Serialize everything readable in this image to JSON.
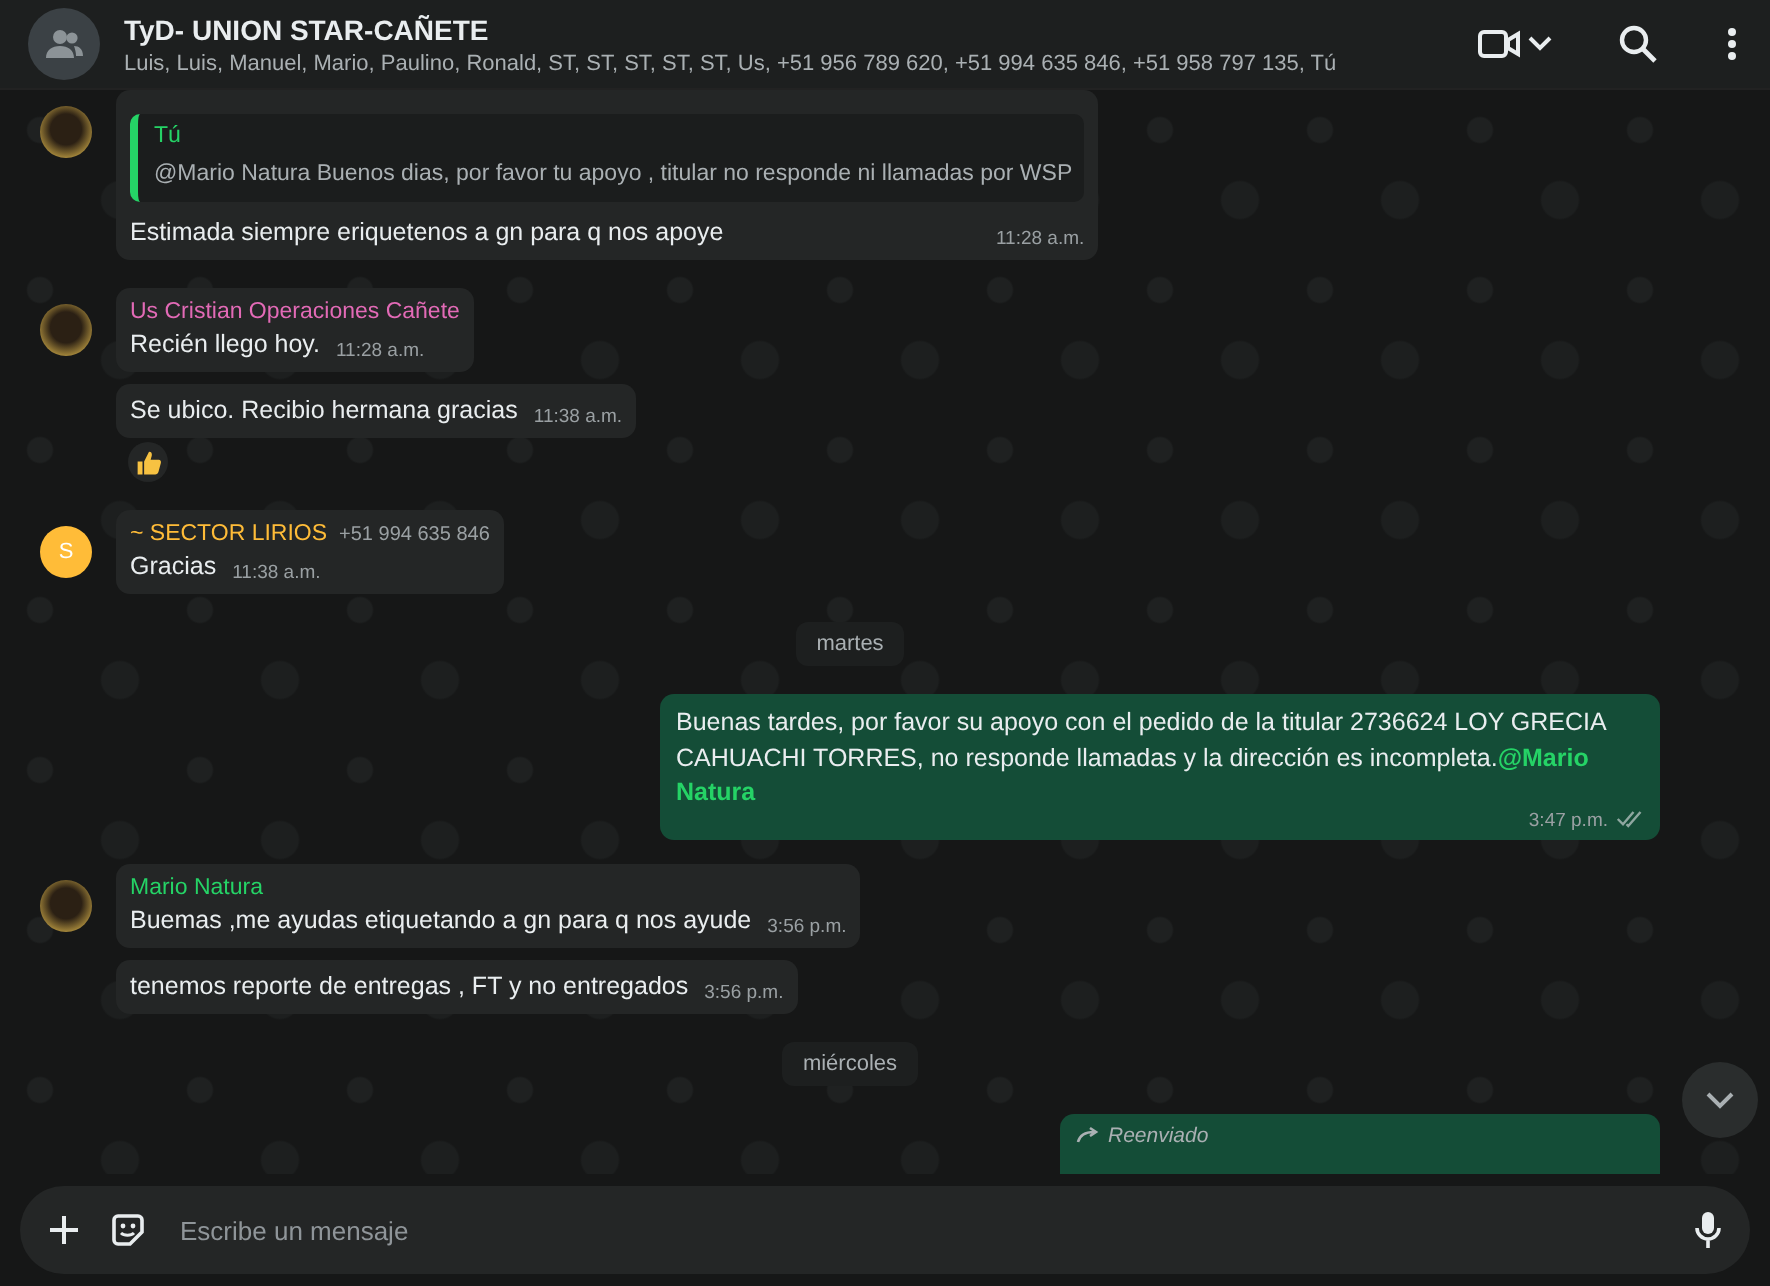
{
  "header": {
    "title": "TyD- UNION STAR-CAÑETE",
    "participants": "Luis, Luis, Manuel, Mario, Paulino, Ronald, ST, ST, ST, ST, ST, Us, +51 956 789 620, +51 994 635 846, +51 958 797 135, Tú"
  },
  "messages": [
    {
      "kind": "incoming",
      "messages": [
        {
          "quote": {
            "author": "Tú",
            "text": "@Mario Natura Buenos dias, por favor tu apoyo , titular no responde ni llamadas por WSP"
          },
          "text": "Estimada siempre eriquetenos a gn para q nos apoye",
          "time": "11:28 a.m."
        }
      ]
    },
    {
      "kind": "incoming",
      "sender": "Us Cristian Operaciones Cañete",
      "color": "#e26ab6",
      "messages": [
        {
          "text": "Recién llego hoy.",
          "time": "11:28 a.m."
        },
        {
          "text": "Se ubico. Recibio hermana gracias",
          "time": "11:38 a.m.",
          "thumbs_up_reaction": true
        }
      ]
    },
    {
      "kind": "incoming",
      "letter": "S",
      "sender": "~ SECTOR LIRIOS",
      "phone": "+51 994 635 846",
      "color": "#ffbc38",
      "messages": [
        {
          "text": "Gracias",
          "time": "11:38 a.m."
        }
      ]
    },
    {
      "kind": "date",
      "text": "martes"
    },
    {
      "kind": "outgoing",
      "text": "Buenas tardes, por favor su apoyo con el pedido de la titular 2736624 LOY GRECIA  CAHUACHI  TORRES, no responde llamadas y la dirección es incompleta.**@Mario Natura**",
      "time": "3:47 p.m.",
      "read": true
    },
    {
      "kind": "incoming",
      "sender": "Mario Natura",
      "color": "#25d366",
      "messages": [
        {
          "text": "Buemas ,me ayudas etiquetando a gn para q nos ayude",
          "time": "3:56 p.m."
        },
        {
          "text": "tenemos reporte de entregas , FT y no entregados",
          "time": "3:56 p.m."
        }
      ]
    },
    {
      "kind": "date",
      "text": "miércoles"
    },
    {
      "kind": "forwarded",
      "label": "Reenviado"
    }
  ],
  "composer": {
    "placeholder": "Escribe un mensaje"
  }
}
